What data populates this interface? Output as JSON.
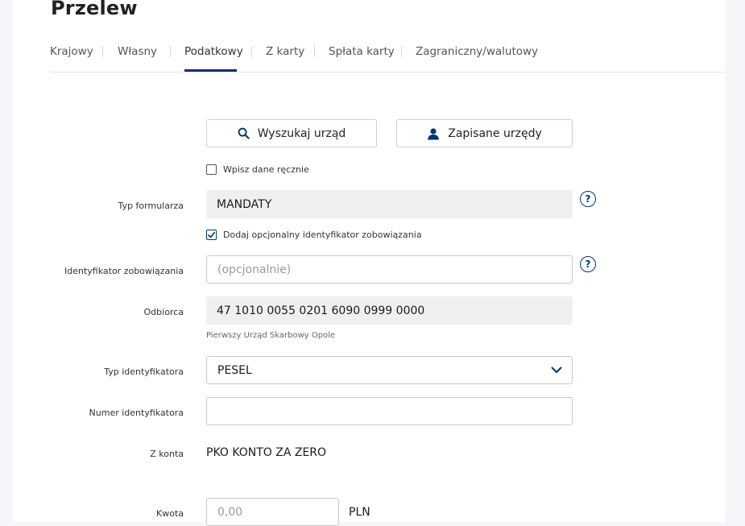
{
  "page": {
    "title": "Przelew"
  },
  "tabs": [
    {
      "label": "Krajowy"
    },
    {
      "label": "Własny"
    },
    {
      "label": "Podatkowy",
      "active": true
    },
    {
      "label": "Z karty"
    },
    {
      "label": "Spłata karty"
    },
    {
      "label": "Zagraniczny/walutowy"
    }
  ],
  "actions": {
    "search_office": "Wyszukaj urząd",
    "saved_offices": "Zapisane urzędy",
    "search_icon": "search-icon",
    "user_icon": "user-icon"
  },
  "manual_entry": {
    "label": "Wpisz dane ręcznie",
    "checked": false
  },
  "form_type": {
    "label": "Typ formularza",
    "value": "MANDATY"
  },
  "optional_id_toggle": {
    "label": "Dodaj opcjonalny identyfikator zobowiązania",
    "checked": true
  },
  "obligation_id": {
    "label": "Identyfikator zobowiązania",
    "placeholder": "(opcjonalnie)"
  },
  "recipient": {
    "label": "Odbiorca",
    "account": "47 1010 0055 0201 6090 0999 0000",
    "name": "Pierwszy Urząd Skarbowy Opole"
  },
  "id_type": {
    "label": "Typ identyfikatora",
    "value": "PESEL"
  },
  "id_number": {
    "label": "Numer identyfikatora",
    "value": ""
  },
  "from_account": {
    "label": "Z konta",
    "value": "PKO KONTO ZA ZERO"
  },
  "amount": {
    "label": "Kwota",
    "placeholder": "0,00",
    "currency": "PLN"
  },
  "help_symbol": "?",
  "colors": {
    "accent": "#003574",
    "readonly_bg": "#efefef"
  }
}
